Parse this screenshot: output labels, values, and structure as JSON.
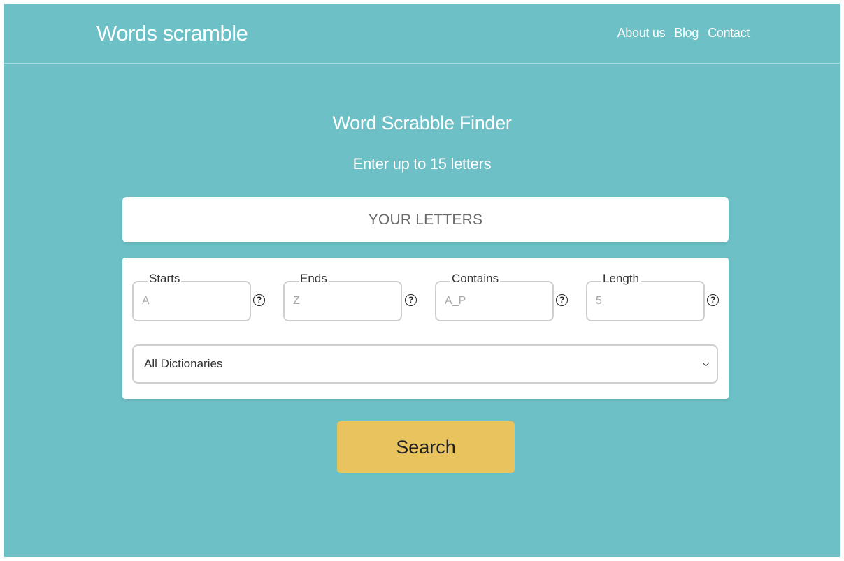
{
  "site": {
    "logo": "Words scramble"
  },
  "nav": {
    "items": [
      {
        "label": "About us"
      },
      {
        "label": "Blog"
      },
      {
        "label": "Contact"
      }
    ]
  },
  "hero": {
    "title": "Word Scrabble Finder",
    "subtitle": "Enter up to 15 letters"
  },
  "letters": {
    "value": "",
    "placeholder": "YOUR LETTERS"
  },
  "filters": {
    "starts": {
      "label": "Starts",
      "value": "",
      "placeholder": "A"
    },
    "ends": {
      "label": "Ends",
      "value": "",
      "placeholder": "Z"
    },
    "contains": {
      "label": "Contains",
      "value": "",
      "placeholder": "A_P"
    },
    "length": {
      "label": "Length",
      "value": "",
      "placeholder": "5"
    },
    "help_glyph": "?"
  },
  "dictionary": {
    "selected": "All Dictionaries"
  },
  "search": {
    "label": "Search"
  },
  "colors": {
    "background": "#6cc0c6",
    "button": "#e9c35e",
    "card": "#ffffff"
  },
  "icons": {
    "help": "question-circle-icon",
    "select": "chevron-down-icon"
  }
}
